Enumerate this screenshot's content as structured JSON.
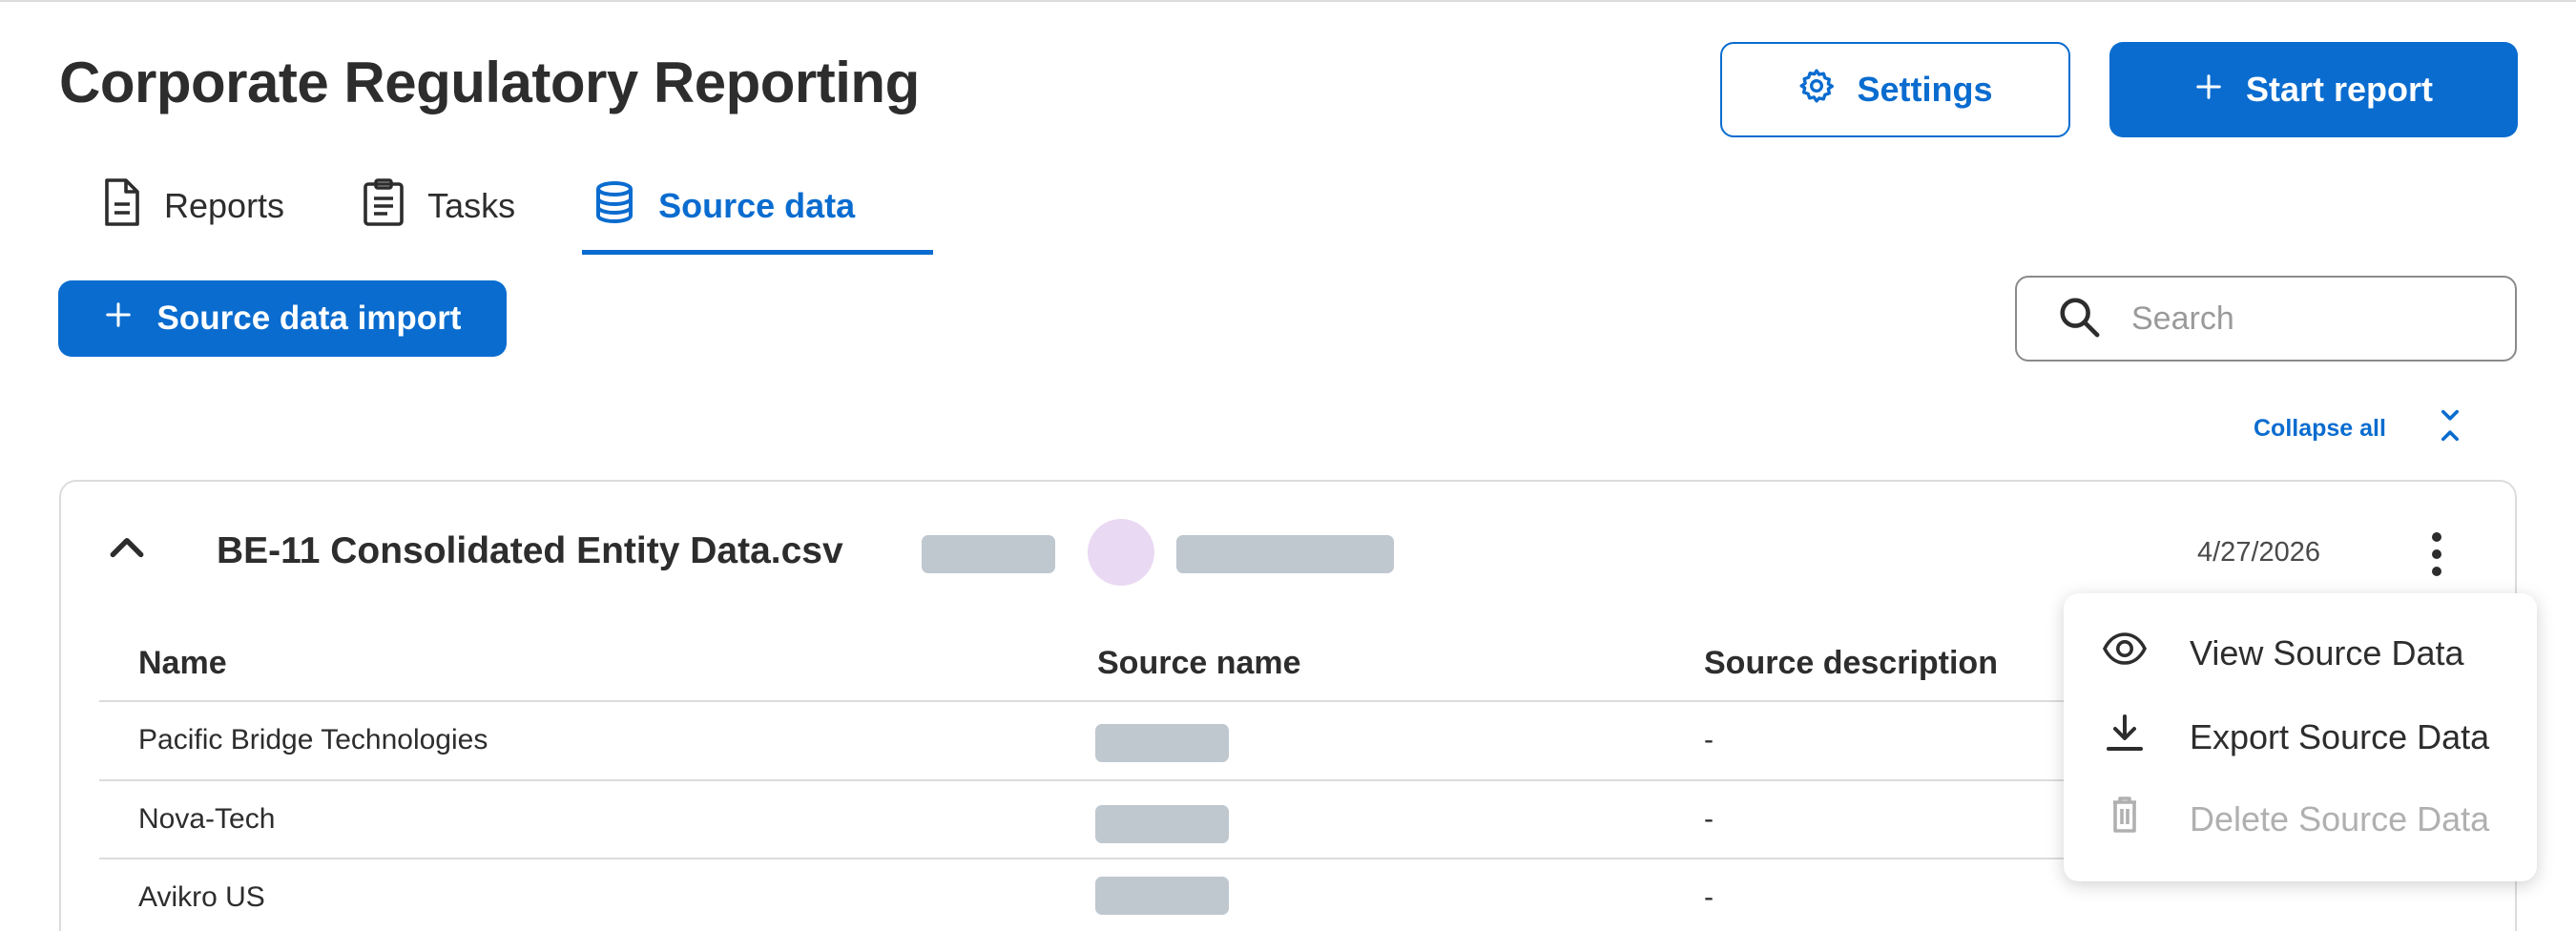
{
  "header": {
    "title": "Corporate Regulatory Reporting",
    "settings_label": "Settings",
    "start_report_label": "Start report"
  },
  "tabs": [
    {
      "label": "Reports",
      "icon": "document-icon",
      "active": false
    },
    {
      "label": "Tasks",
      "icon": "clipboard-icon",
      "active": false
    },
    {
      "label": "Source data",
      "icon": "database-icon",
      "active": true
    }
  ],
  "toolbar": {
    "import_label": "Source data import",
    "search_placeholder": "Search",
    "collapse_all_label": "Collapse all"
  },
  "source_file": {
    "name": "BE-11 Consolidated Entity Data.csv",
    "date": "4/27/2026"
  },
  "table": {
    "columns": [
      "Name",
      "Source name",
      "Source description"
    ],
    "rows": [
      {
        "name": "Pacific Bridge Technologies",
        "description": "-"
      },
      {
        "name": "Nova-Tech",
        "description": "-"
      },
      {
        "name": "Avikro US",
        "description": "-"
      }
    ]
  },
  "context_menu": {
    "items": [
      {
        "label": "View Source Data",
        "icon": "eye-icon",
        "disabled": false
      },
      {
        "label": "Export Source Data",
        "icon": "download-icon",
        "disabled": false
      },
      {
        "label": "Delete Source Data",
        "icon": "trash-icon",
        "disabled": true
      }
    ]
  },
  "colors": {
    "primary": "#0a6ccf",
    "text": "#2d2d2d",
    "border": "#dcdcdc",
    "skeleton": "#bfc7cf",
    "avatar": "#ead9f3",
    "disabled": "#b0b0b0"
  }
}
